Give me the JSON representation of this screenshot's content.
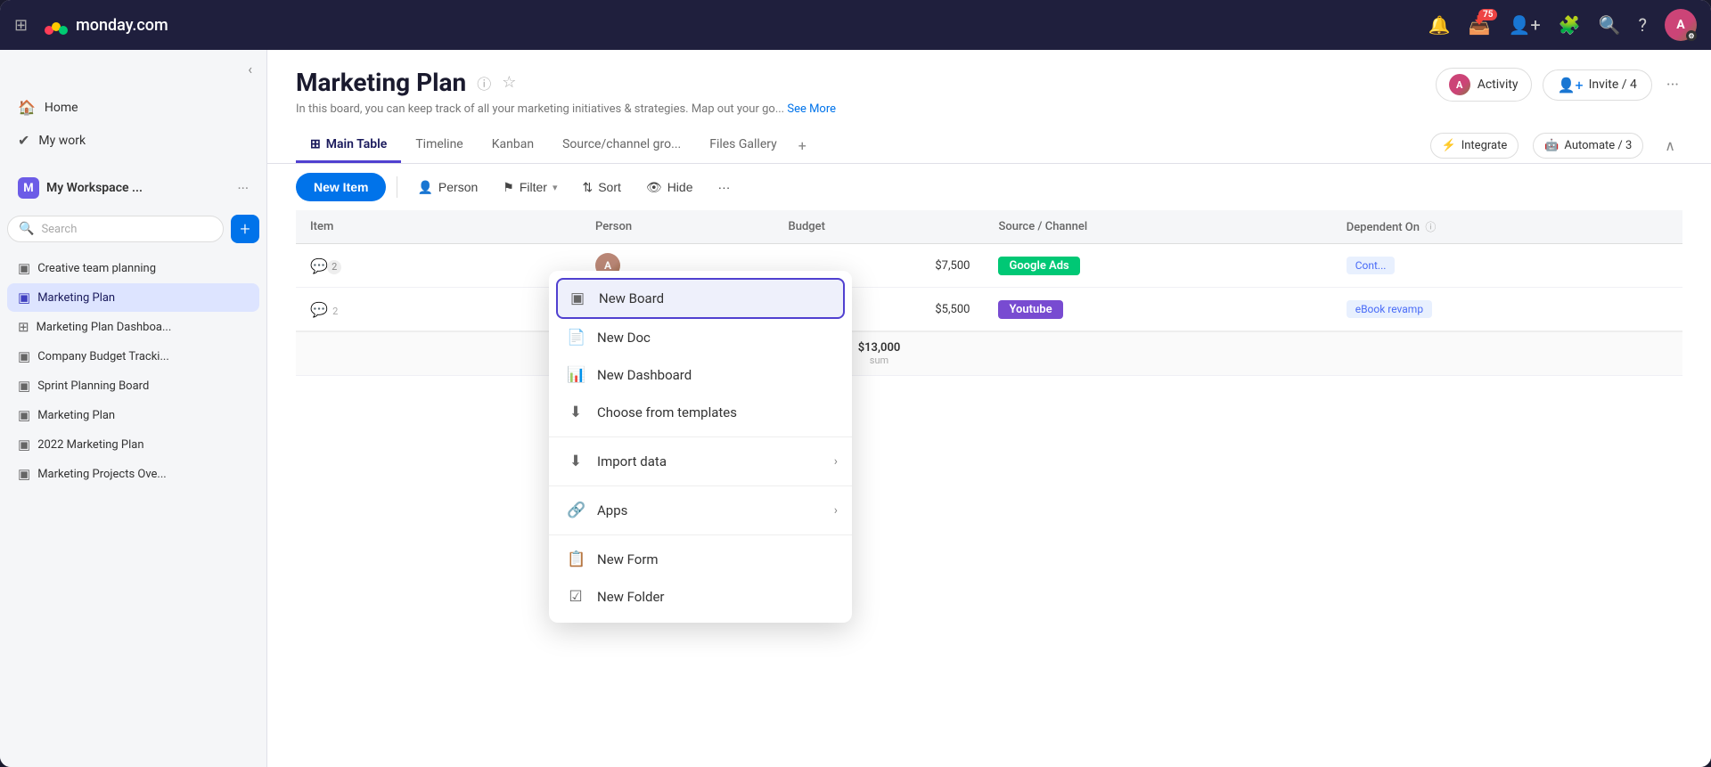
{
  "topNav": {
    "logo_text": "monday.com",
    "notification_badge": "75"
  },
  "sidebar": {
    "collapse_label": "‹",
    "nav_items": [
      {
        "id": "home",
        "label": "Home",
        "icon": "🏠"
      },
      {
        "id": "mywork",
        "label": "My work",
        "icon": "✔"
      }
    ],
    "workspace_name": "My Workspace ...",
    "search_placeholder": "Search",
    "boards": [
      {
        "id": "creative",
        "label": "Creative team planning",
        "active": false
      },
      {
        "id": "marketing-plan",
        "label": "Marketing Plan",
        "active": true
      },
      {
        "id": "marketing-dash",
        "label": "Marketing Plan Dashboa...",
        "active": false
      },
      {
        "id": "company-budget",
        "label": "Company Budget Tracki...",
        "active": false
      },
      {
        "id": "sprint",
        "label": "Sprint Planning Board",
        "active": false
      },
      {
        "id": "marketing-plan2",
        "label": "Marketing Plan",
        "active": false
      },
      {
        "id": "2022",
        "label": "2022 Marketing Plan",
        "active": false
      },
      {
        "id": "projects",
        "label": "Marketing Projects Ove...",
        "active": false
      }
    ]
  },
  "board": {
    "title": "Marketing Plan",
    "description": "In this board, you can keep track of all your marketing initiatives & strategies. Map out your go...",
    "see_more": "See More",
    "activity_label": "Activity",
    "invite_label": "Invite / 4"
  },
  "tabs": [
    {
      "id": "main-table",
      "label": "Main Table",
      "active": true,
      "icon": "⊞"
    },
    {
      "id": "timeline",
      "label": "Timeline",
      "active": false
    },
    {
      "id": "kanban",
      "label": "Kanban",
      "active": false
    },
    {
      "id": "source",
      "label": "Source/channel gro...",
      "active": false
    },
    {
      "id": "files",
      "label": "Files Gallery",
      "active": false
    }
  ],
  "tabsActions": {
    "integrate_label": "Integrate",
    "automate_label": "Automate / 3"
  },
  "toolbar": {
    "new_item_label": "New Item",
    "person_label": "Person",
    "filter_label": "Filter",
    "sort_label": "Sort",
    "hide_label": "Hide"
  },
  "table": {
    "columns": [
      "Item",
      "Person",
      "Budget",
      "Source / Channel",
      "Dependent On"
    ],
    "rows": [
      {
        "comment_icon": "💬",
        "person_type": "brown",
        "budget": "$7,500",
        "channel": "Google Ads",
        "channel_type": "green",
        "dependent": "Cont...",
        "dependent_type": "blue"
      },
      {
        "comment_icon": "💬",
        "num": "2",
        "person_type": "gray",
        "budget": "$5,500",
        "channel": "Youtube",
        "channel_type": "purple",
        "dependent": "eBook revamp",
        "dependent_type": "blue"
      }
    ],
    "sum_budget": "$13,000",
    "sum_label": "sum"
  },
  "dropdown": {
    "items": [
      {
        "id": "new-board",
        "label": "New Board",
        "icon": "▣",
        "highlighted": true
      },
      {
        "id": "new-doc",
        "label": "New Doc",
        "icon": "📄",
        "highlighted": false
      },
      {
        "id": "new-dashboard",
        "label": "New Dashboard",
        "icon": "📊",
        "highlighted": false
      },
      {
        "id": "choose-templates",
        "label": "Choose from templates",
        "icon": "⬇",
        "highlighted": false
      },
      {
        "id": "import-data",
        "label": "Import data",
        "icon": "⬇",
        "arrow": "›",
        "highlighted": false
      },
      {
        "id": "apps",
        "label": "Apps",
        "icon": "🔗",
        "arrow": "›",
        "highlighted": false
      },
      {
        "id": "new-form",
        "label": "New Form",
        "icon": "📋",
        "highlighted": false
      },
      {
        "id": "new-folder",
        "label": "New Folder",
        "icon": "☑",
        "highlighted": false
      }
    ]
  }
}
